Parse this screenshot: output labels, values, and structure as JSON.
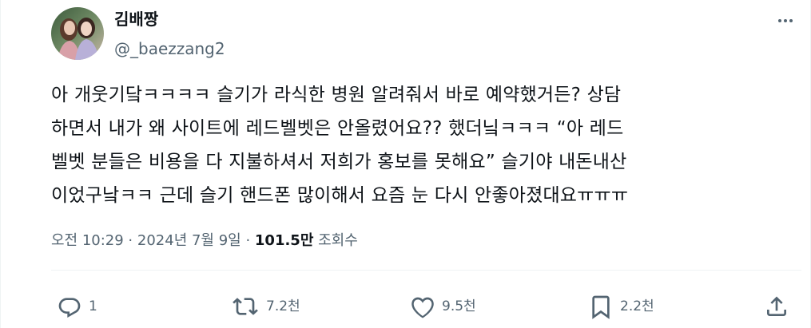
{
  "author": {
    "display_name": "김배짱",
    "handle": "@_baezzang2",
    "avatar_icon": "profile-photo"
  },
  "tweet": {
    "lines": [
      "아 개웃기닼ㅋㅋㅋㅋ 슬기가 라식한 병원 알려줘서 바로 예약했거든? 상담",
      "하면서 내가 왜 사이트에 레드벨벳은 안올렸어요?? 했더닠ㅋㅋㅋ “아 레드",
      "벨벳 분들은 비용을 다 지불하셔서 저희가 홍보를 못해요” 슬기야 내돈내산",
      "이었구낰ㅋㅋ 근데 슬기 핸드폰 많이해서 요즘 눈 다시 안좋아졌대요ㅠㅠㅠ"
    ],
    "time": "오전 10:29 · 2024년 7월 9일",
    "separator": " · ",
    "views_count": "101.5만",
    "views_label": " 조회수"
  },
  "actions": {
    "reply": {
      "icon": "reply-icon",
      "count": "1"
    },
    "retweet": {
      "icon": "retweet-icon",
      "count": "7.2천"
    },
    "like": {
      "icon": "heart-icon",
      "count": "9.5천"
    },
    "bookmark": {
      "icon": "bookmark-icon",
      "count": "2.2천"
    },
    "share": {
      "icon": "share-icon"
    }
  },
  "colors": {
    "text": "#0f1419",
    "secondary": "#536471",
    "divider": "#eff3f4"
  }
}
